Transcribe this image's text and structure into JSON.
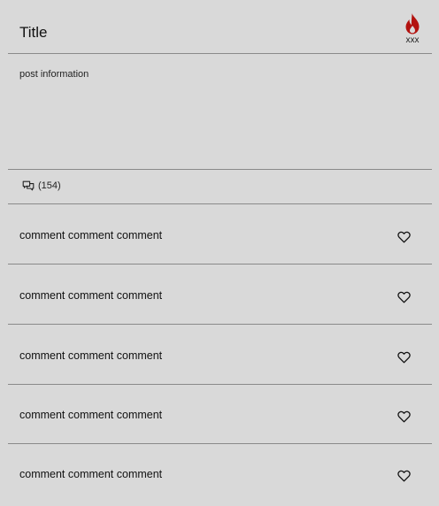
{
  "post": {
    "title": "Title",
    "hot_label": "xxx",
    "info": "post information",
    "comment_count": "(154)"
  },
  "icons": {
    "hot": "flame-icon",
    "comments": "chat-bubbles-icon",
    "like": "heart-outline-icon"
  },
  "colors": {
    "background": "#d9d9d9",
    "divider": "#8a8a8a",
    "flame": "#b3120f"
  },
  "comments": [
    {
      "text": "comment comment comment"
    },
    {
      "text": "comment comment comment"
    },
    {
      "text": "comment comment comment"
    },
    {
      "text": "comment comment comment"
    },
    {
      "text": "comment comment comment"
    }
  ]
}
